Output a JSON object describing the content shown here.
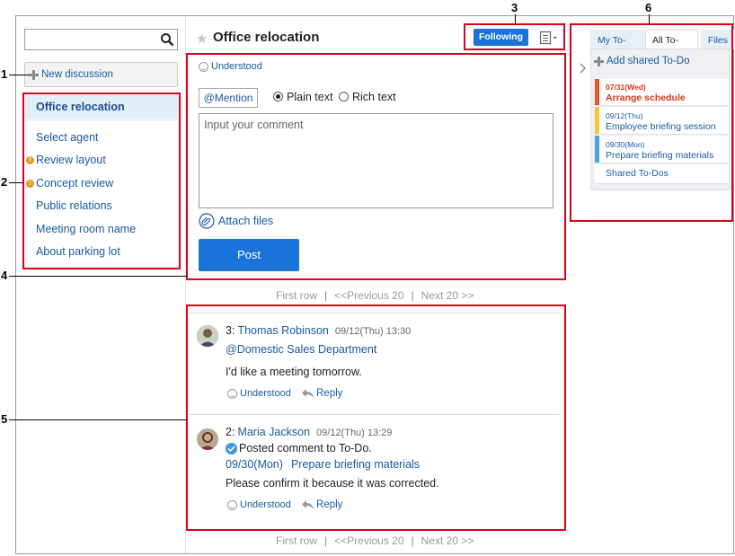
{
  "search": {
    "placeholder": "",
    "value": "",
    "icon": "search-icon"
  },
  "sidebar": {
    "new_discussion": "New discussion",
    "items": [
      {
        "label": "Office relocation",
        "selected": true,
        "warning": false
      },
      {
        "label": "Select agent",
        "selected": false,
        "warning": false
      },
      {
        "label": "Review layout",
        "selected": false,
        "warning": true
      },
      {
        "label": "Concept review",
        "selected": false,
        "warning": true
      },
      {
        "label": "Public relations",
        "selected": false,
        "warning": false
      },
      {
        "label": "Meeting room name",
        "selected": false,
        "warning": false
      },
      {
        "label": "About parking lot",
        "selected": false,
        "warning": false
      }
    ]
  },
  "header": {
    "title": "Office relocation",
    "following_label": "Following",
    "accent_color": "#1a73d9"
  },
  "composer": {
    "understood_label": "Understood",
    "mention_label": "@Mention",
    "plain_text_label": "Plain text",
    "rich_text_label": "Rich text",
    "placeholder": "Input your comment",
    "attach_label": "Attach files",
    "post_label": "Post"
  },
  "pager": {
    "first": "First row",
    "sep": "|",
    "previous": "<<Previous 20",
    "next": "Next 20 >>"
  },
  "comments": [
    {
      "number": "3:",
      "author": "Thomas Robinson",
      "date": "09/12(Thu) 13:30",
      "mention": "@Domestic Sales Department",
      "body": "I'd like a meeting tomorrow.",
      "understood_label": "Understood",
      "reply_label": "Reply"
    },
    {
      "number": "2:",
      "author": "Maria Jackson",
      "date": "09/12(Thu) 13:29",
      "notice": "Posted comment to To-Do.",
      "todo_date": "09/30(Mon)",
      "todo_title": "Prepare briefing materials",
      "body": "Please confirm it because it was corrected.",
      "understood_label": "Understood",
      "reply_label": "Reply"
    }
  ],
  "todo": {
    "tabs": [
      "My To-Dos",
      "All To-Dos",
      "Files"
    ],
    "active_tab": "All To-Dos",
    "add_label": "Add shared To-Do",
    "items": [
      {
        "date": "07/31(Wed)",
        "title": "Arrange schedule",
        "color": "#e55a2b",
        "overdue": true
      },
      {
        "date": "09/12(Thu)",
        "title": "Employee briefing session",
        "color": "#f5c542",
        "overdue": false
      },
      {
        "date": "09/30(Mon)",
        "title": "Prepare briefing materials",
        "color": "#4aa6e0",
        "overdue": false
      }
    ],
    "shared_label": "Shared To-Dos"
  },
  "callouts": [
    "1",
    "2",
    "3",
    "4",
    "5",
    "6"
  ]
}
